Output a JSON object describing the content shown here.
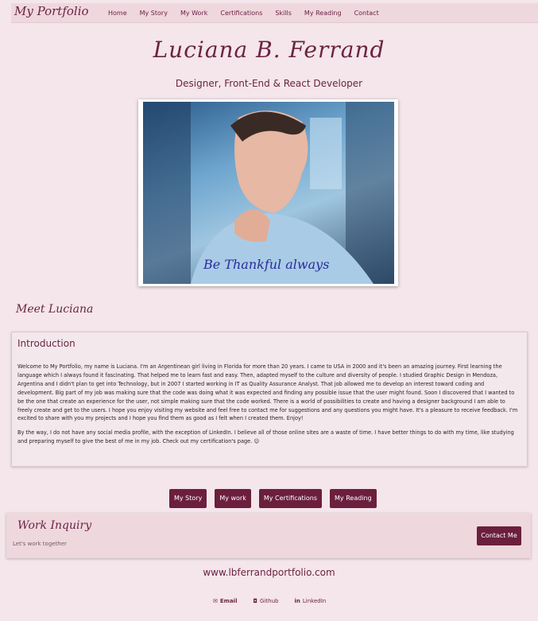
{
  "nav": {
    "brand": "My Portfolio",
    "links": [
      "Home",
      "My Story",
      "My Work",
      "Certifications",
      "Skills",
      "My Reading",
      "Contact"
    ]
  },
  "hero": {
    "name": "Luciana B. Ferrand",
    "subtitle": "Designer, Front-End & React Developer",
    "photo_caption": "Be Thankful always"
  },
  "meet": {
    "heading": "Meet Luciana"
  },
  "intro": {
    "title": "Introduction",
    "paragraph1": "Welcome to My Portfolio, my name is Luciana. I'm an Argentinean girl living in Florida for more than 20 years. I came to USA in 2000 and it's been an amazing journey. First learning the language which I always found it fascinating. That helped me to learn fast and easy. Then, adapted myself to the culture and diversity of people. I studied Graphic Design in Mendoza, Argentina and I didn't plan to get into Technology, but in 2007 I started working in IT as Quality Assurance Analyst. That job allowed me to develop an interest toward coding and development. Big part of my job was making sure that the code was doing what it was expected and finding any possible issue that the user might found. Soon I discovered that I wanted to be the one that create an experience for the user, not simple making sure that the code worked. There is a world of possibilities to create and having a designer background I am able to freely create and get to the users. I hope you enjoy visiting my website and feel free to contact me for suggestions and any questions you might have. It's a pleasure to receive feedback. I'm excited to share with you my projects and I hope you find them as good as I felt when I created them. Enjoy!",
    "paragraph2": "By the way, I do not have any social media profile, with the exception of LinkedIn. I believe all of those online sites are a waste of time. I have better things to do with my time, like studying and preparing myself to give the best of me in my job. Check out my certification's page. 😉"
  },
  "buttons": [
    "My Story",
    "My work",
    "My Certifications",
    "My Reading"
  ],
  "inquiry": {
    "title": "Work Inquiry",
    "subtitle": "Let's work together",
    "contact_label": "Contact Me"
  },
  "site_url": "www.lbferrandportfolio.com",
  "footer": {
    "links": [
      {
        "icon": "email-icon",
        "label": "Email"
      },
      {
        "icon": "github-icon",
        "label": "Github"
      },
      {
        "icon": "linkedin-icon",
        "label": "LinkedIn"
      }
    ]
  },
  "colors": {
    "accent": "#6b1f3d",
    "background": "#f4e6ea",
    "nav_bg": "#efd7de"
  }
}
